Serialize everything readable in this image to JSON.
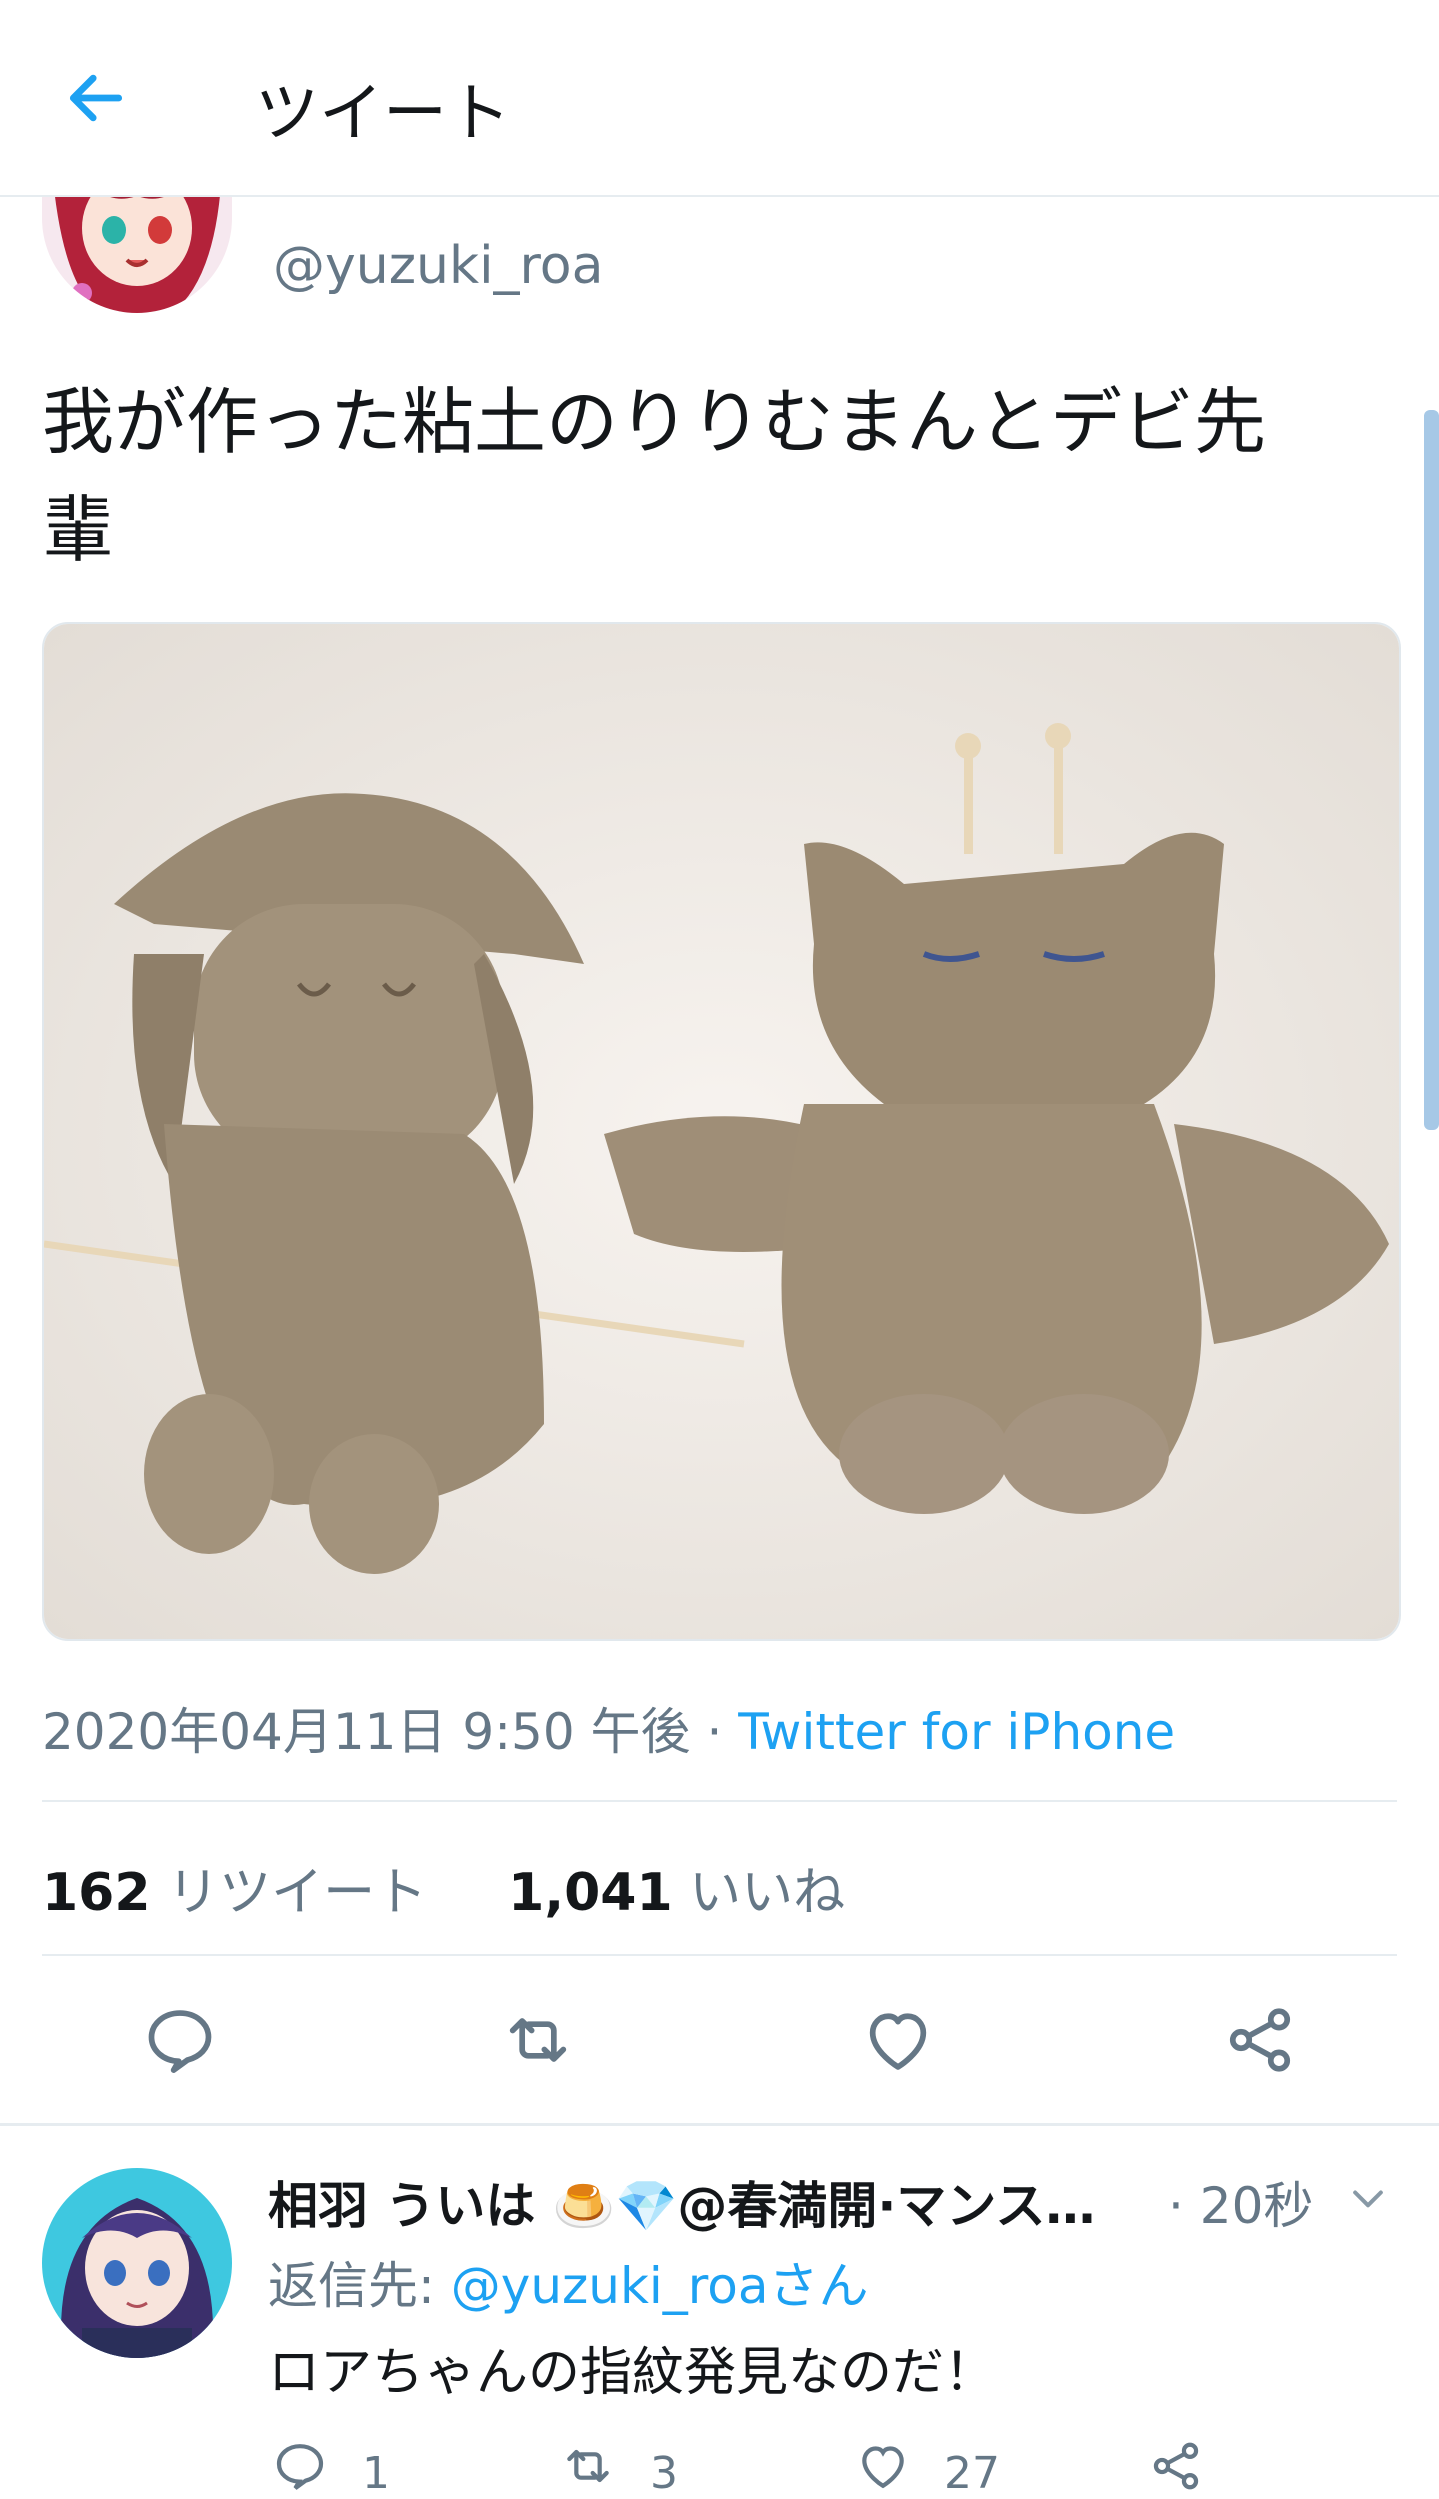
{
  "header": {
    "title": "ツイート"
  },
  "tweet": {
    "handle": "@yuzuki_roa",
    "text_line1": "我が作った粘土のりりむまんとデビ先",
    "text_line2": "輩",
    "timestamp": "2020年04月11日 9:50 午後",
    "separator": "·",
    "source": "Twitter for iPhone",
    "retweet_count": "162",
    "retweet_label": "リツイート",
    "like_count": "1,041",
    "like_label": "いいね"
  },
  "reply": {
    "name": "相羽 ういは 🍮💎@春満開·マンス…",
    "time": "· 20秒",
    "reply_to_prefix": "返信先: ",
    "reply_to_mention": "@yuzuki_roaさん",
    "text": "ロアちゃんの指紋発見なのだ！",
    "reply_count": "1",
    "retweet_count": "3",
    "like_count": "27"
  },
  "colors": {
    "accent": "#1da1f2",
    "muted": "#657786",
    "text": "#14171a"
  }
}
